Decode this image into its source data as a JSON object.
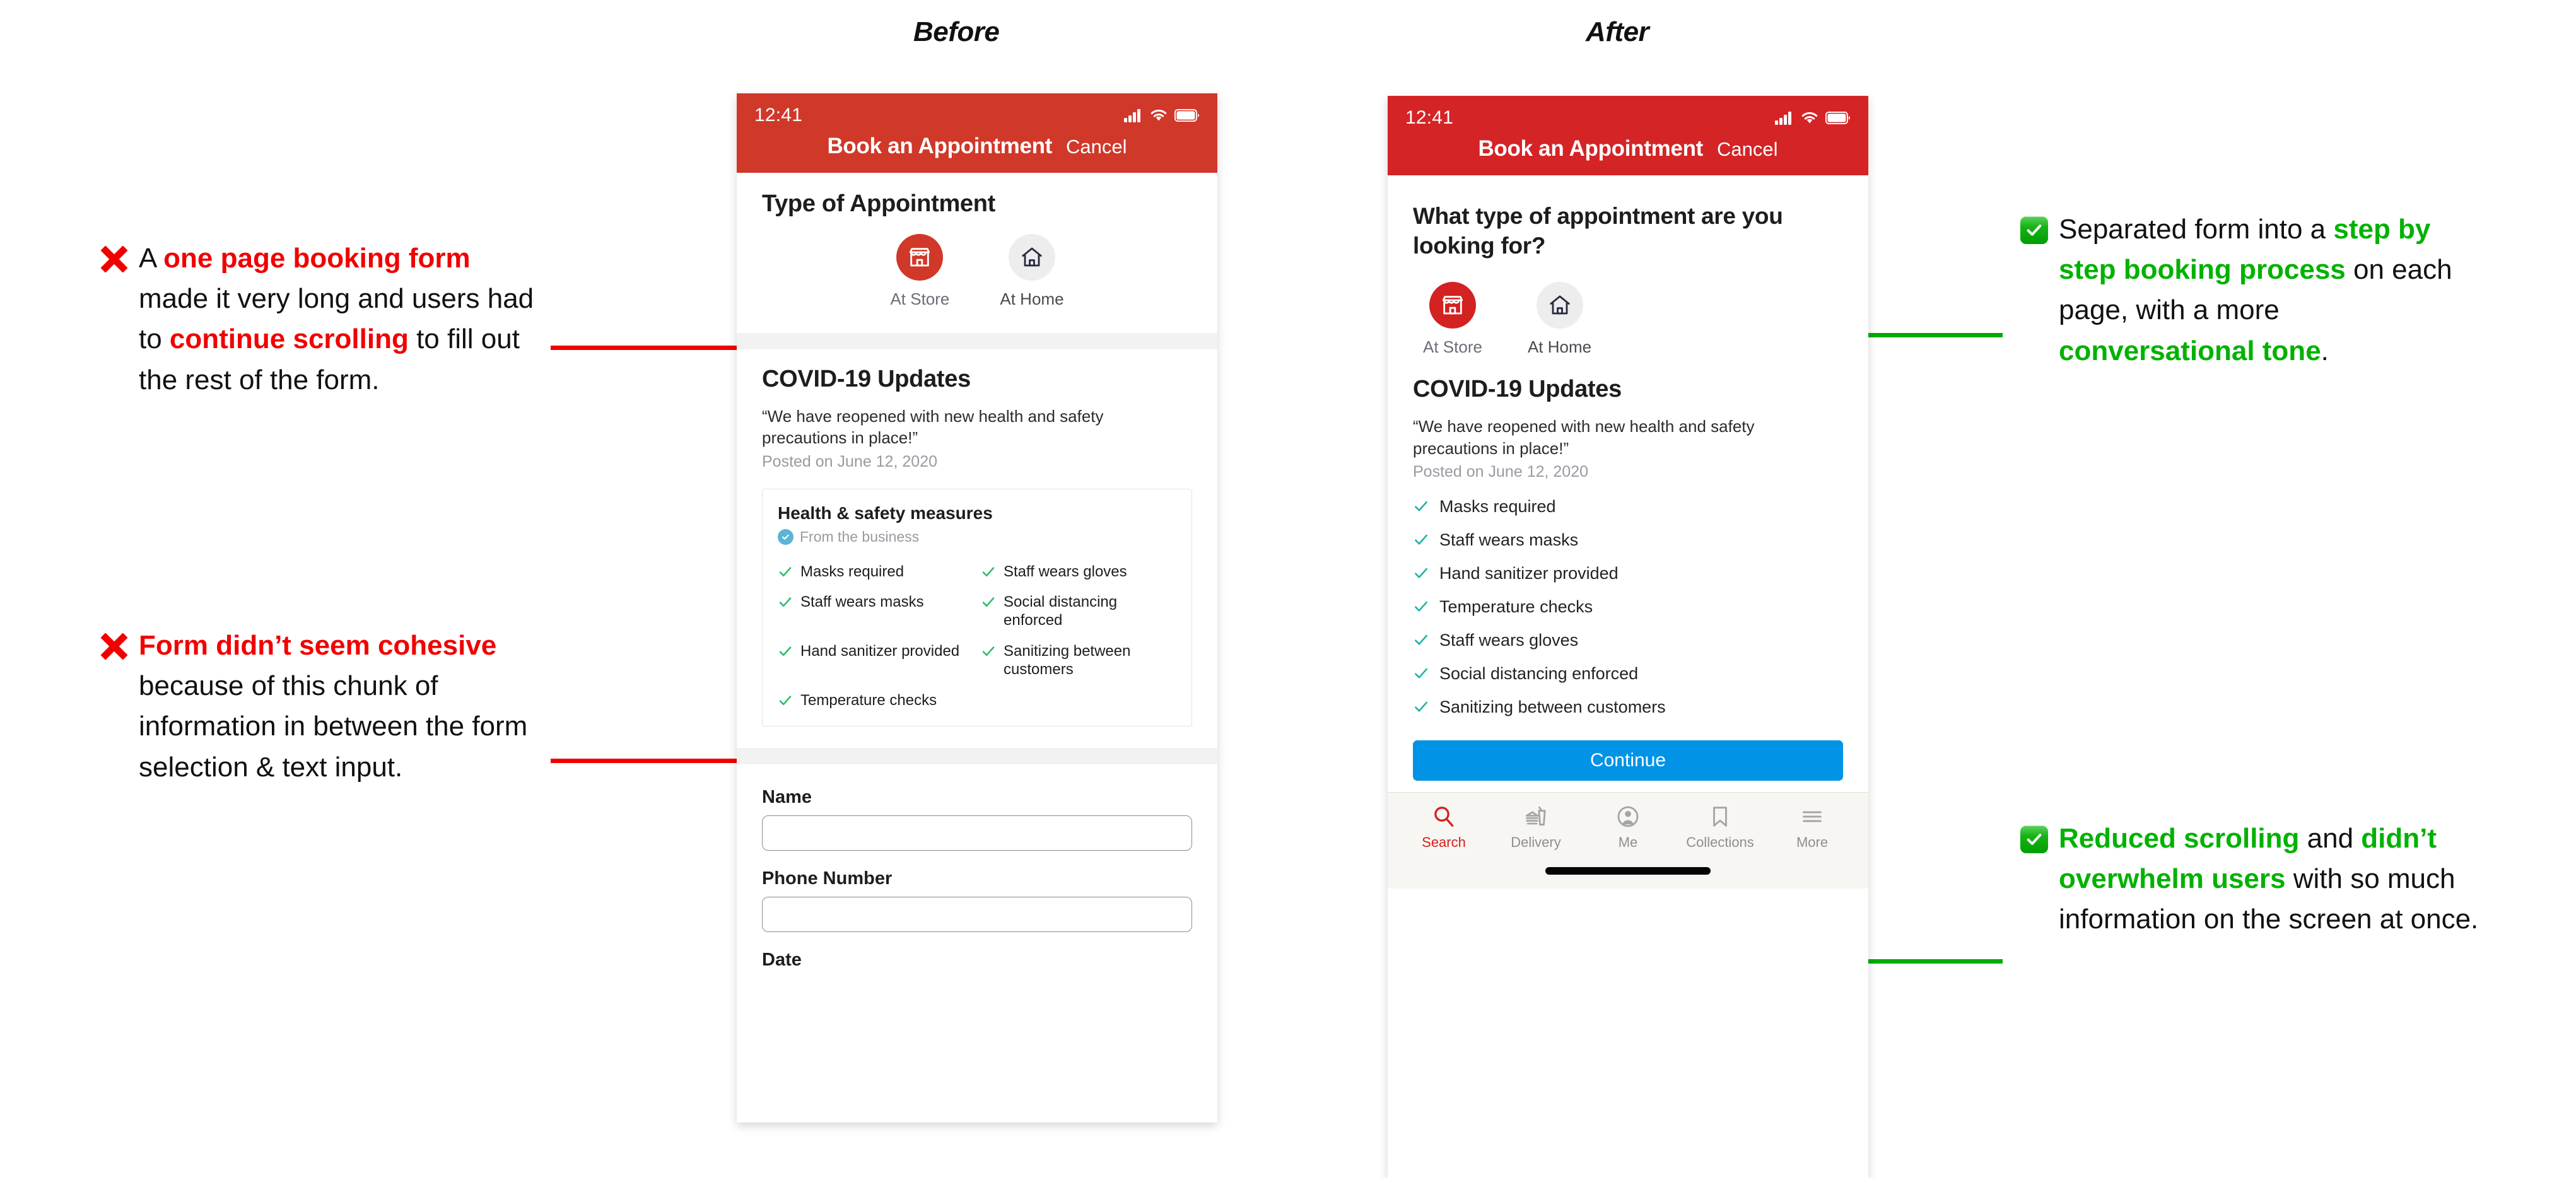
{
  "sections": {
    "before_label": "Before",
    "after_label": "After"
  },
  "annotations": {
    "left": [
      {
        "mark": "red-x-icon",
        "segments": [
          {
            "text": "A ",
            "style": "plain"
          },
          {
            "text": "one page booking form",
            "style": "red"
          },
          {
            "text": " made it very long and users had to ",
            "style": "plain"
          },
          {
            "text": "continue scrolling",
            "style": "red"
          },
          {
            "text": " to fill out the rest of the form.",
            "style": "plain"
          }
        ]
      },
      {
        "mark": "red-x-icon",
        "segments": [
          {
            "text": "Form didn’t seem cohesive",
            "style": "red"
          },
          {
            "text": " because of this chunk of information in between the form selection & text input.",
            "style": "plain"
          }
        ]
      }
    ],
    "right": [
      {
        "mark": "green-check-icon",
        "segments": [
          {
            "text": "Separated form into a ",
            "style": "plain"
          },
          {
            "text": "step by step booking process",
            "style": "green"
          },
          {
            "text": " on each page, with a more ",
            "style": "plain"
          },
          {
            "text": "conversational tone",
            "style": "green"
          },
          {
            "text": ".",
            "style": "plain"
          }
        ]
      },
      {
        "mark": "green-check-icon",
        "segments": [
          {
            "text": "Reduced scrolling",
            "style": "green"
          },
          {
            "text": " and ",
            "style": "plain"
          },
          {
            "text": "didn’t overwhelm users",
            "style": "green"
          },
          {
            "text": " with so much information on the screen at once.",
            "style": "plain"
          }
        ]
      }
    ]
  },
  "colors": {
    "before_header_red": "#d0382a",
    "after_header_red": "#d42426",
    "annotation_red": "#f20000",
    "annotation_green": "#00b200",
    "connector_red": "#f20000",
    "connector_green": "#00ac00",
    "continue_blue": "#0093e6",
    "check_green_before": "#2dbd6e",
    "check_teal_after": "#1bb5a3",
    "tab_active_red": "#d42121"
  },
  "before_phone": {
    "status": {
      "time": "12:41",
      "icons": [
        "cellular-signal-icon",
        "wifi-icon",
        "battery-icon"
      ]
    },
    "nav": {
      "title": "Book an Appointment",
      "cancel": "Cancel"
    },
    "type_section": {
      "heading": "Type of Appointment",
      "options": [
        {
          "label": "At Store",
          "icon": "storefront-icon",
          "selected": true
        },
        {
          "label": "At Home",
          "icon": "house-icon",
          "selected": false
        }
      ]
    },
    "covid": {
      "heading": "COVID-19 Updates",
      "quote": "“We have reopened with new health and safety precautions in place!”",
      "posted": "Posted on June 12, 2020",
      "card": {
        "title": "Health & safety measures",
        "source": "From the business",
        "source_icon": "verified-badge-icon",
        "items_left": [
          "Masks required",
          "Staff wears masks",
          "Hand sanitizer provided",
          "Temperature checks"
        ],
        "items_right": [
          "Staff wears gloves",
          "Social distancing enforced",
          "Sanitizing between customers"
        ]
      }
    },
    "form": {
      "fields": [
        {
          "label": "Name",
          "value": "",
          "placeholder": ""
        },
        {
          "label": "Phone Number",
          "value": "",
          "placeholder": ""
        },
        {
          "label": "Date",
          "value": "",
          "placeholder": ""
        }
      ]
    }
  },
  "after_phone": {
    "status": {
      "time": "12:41",
      "icons": [
        "cellular-signal-icon",
        "wifi-icon",
        "battery-icon"
      ]
    },
    "nav": {
      "title": "Book an Appointment",
      "cancel": "Cancel"
    },
    "question": "What type of appointment are you looking for?",
    "type_options": [
      {
        "label": "At Store",
        "icon": "storefront-icon",
        "selected": true
      },
      {
        "label": "At Home",
        "icon": "house-icon",
        "selected": false
      }
    ],
    "covid": {
      "heading": "COVID-19 Updates",
      "quote": "“We have reopened with new health and safety precautions in place!”",
      "posted": "Posted on June 12, 2020",
      "measures": [
        "Masks required",
        "Staff wears masks",
        "Hand sanitizer provided",
        "Temperature checks",
        "Staff wears gloves",
        "Social distancing enforced",
        "Sanitizing between customers"
      ]
    },
    "continue_label": "Continue",
    "tabbar": [
      {
        "label": "Search",
        "icon": "search-icon",
        "active": true
      },
      {
        "label": "Delivery",
        "icon": "takeout-bag-icon",
        "active": false
      },
      {
        "label": "Me",
        "icon": "user-avatar-icon",
        "active": false
      },
      {
        "label": "Collections",
        "icon": "bookmark-icon",
        "active": false
      },
      {
        "label": "More",
        "icon": "hamburger-menu-icon",
        "active": false
      }
    ]
  }
}
